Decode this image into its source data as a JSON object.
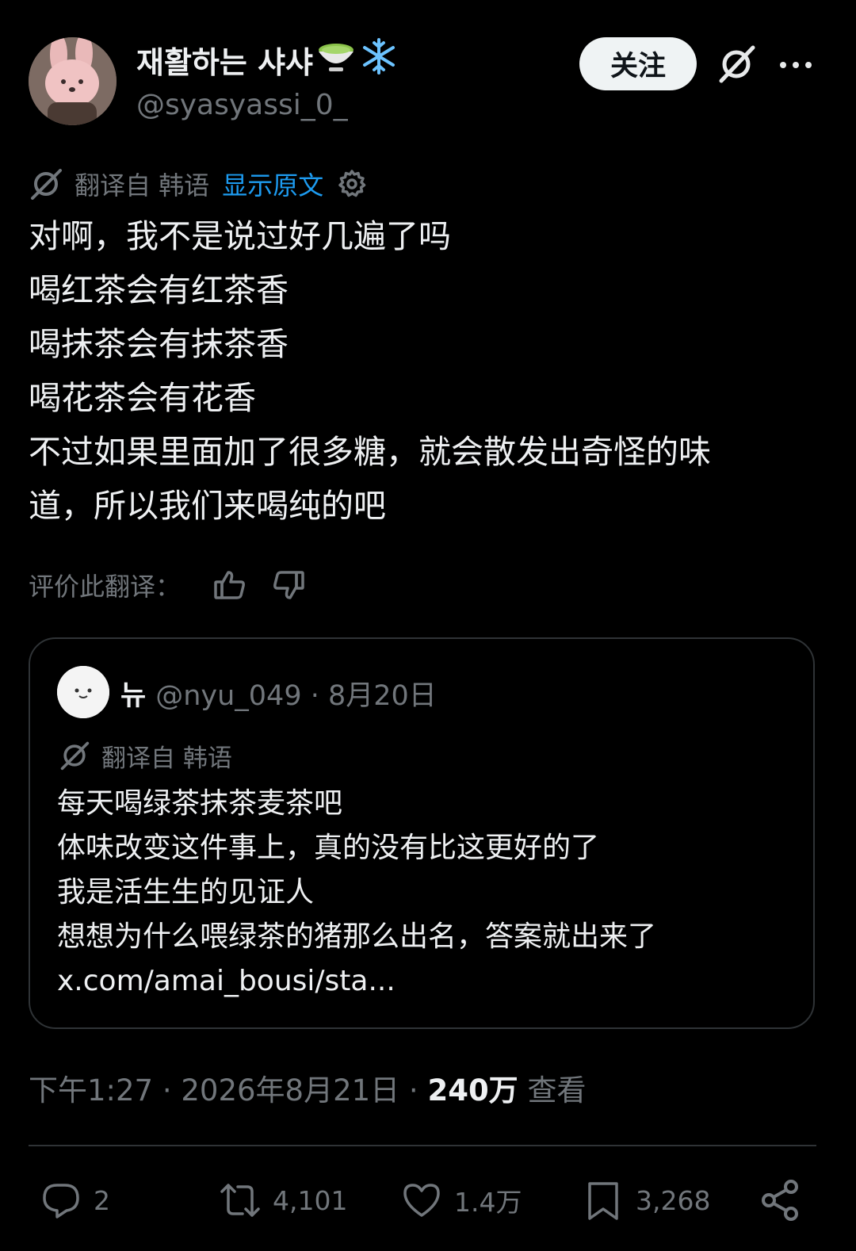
{
  "author": {
    "display_name": "재활하는 샤샤",
    "emoji_1": "matcha-bowl-emoji",
    "emoji_2": "snowflake-emoji",
    "handle": "@syasyassi_0_"
  },
  "header": {
    "follow_label": "关注",
    "icons": [
      "grok-icon",
      "more-icon"
    ]
  },
  "translation": {
    "notice": "翻译自 韩语",
    "show_original": "显示原文"
  },
  "post": {
    "lines": [
      "对啊，我不是说过好几遍了吗",
      "喝红茶会有红茶香",
      "喝抹茶会有抹茶香",
      "喝花茶会有花香",
      "不过如果里面加了很多糖，就会散发出奇怪的味",
      "道，所以我们来喝纯的吧"
    ]
  },
  "rate": {
    "label": "评价此翻译："
  },
  "quote": {
    "name": "뉴",
    "meta": "@nyu_049 · 8月20日",
    "translation_notice": "翻译自 韩语",
    "lines": [
      "每天喝绿茶抹茶麦茶吧",
      "体味改变这件事上，真的没有比这更好的了",
      "我是活生生的见证人",
      "想想为什么喂绿茶的猪那么出名，答案就出来了",
      "x.com/amai_bousi/sta..."
    ]
  },
  "timestamp": {
    "time_date": "下午1:27 · 2026年8月21日 · ",
    "views_count": "240万",
    "views_label": " 查看"
  },
  "actions": {
    "replies": "2",
    "reposts": "4,101",
    "likes": "1.4万",
    "bookmarks": "3,268"
  },
  "colors": {
    "background": "#000000",
    "text": "#e7e9ea",
    "muted": "#71767b",
    "link": "#1d9bf0",
    "border": "#2f3336"
  }
}
